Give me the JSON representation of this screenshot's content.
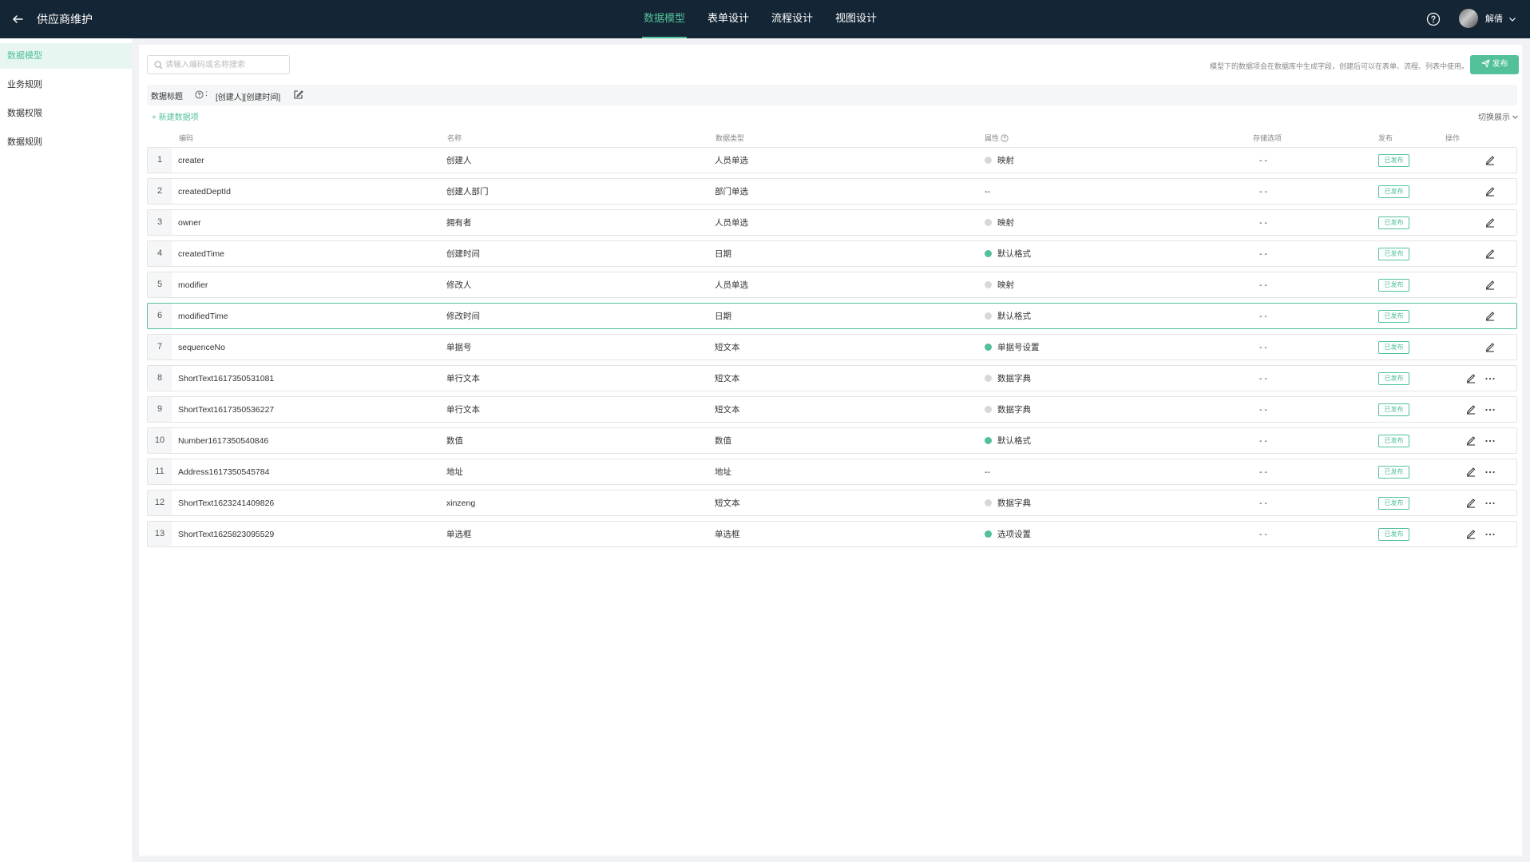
{
  "topbar": {
    "title": "供应商维护",
    "tabs": [
      {
        "label": "数据模型",
        "active": true
      },
      {
        "label": "表单设计",
        "active": false
      },
      {
        "label": "流程设计",
        "active": false
      },
      {
        "label": "视图设计",
        "active": false
      }
    ],
    "username": "解倩"
  },
  "sidebar": {
    "items": [
      {
        "label": "数据模型",
        "active": true
      },
      {
        "label": "业务规则",
        "active": false
      },
      {
        "label": "数据权限",
        "active": false
      },
      {
        "label": "数据规则",
        "active": false
      }
    ]
  },
  "toolbar": {
    "search_placeholder": "请输入编码或名称搜索",
    "hint": "模型下的数据项会在数据库中生成字段，创建后可以在表单、流程、列表中使用。",
    "publish_label": "发布"
  },
  "data_title": {
    "label": "数据标题",
    "colon": ":",
    "value": "[创建人][创建时间]"
  },
  "actions": {
    "new_item": "+ 新建数据项",
    "switch_view": "切换展示"
  },
  "columns": {
    "code": "编码",
    "name": "名称",
    "type": "数据类型",
    "attr": "属性",
    "storage": "存储选项",
    "publish": "发布",
    "ops": "操作"
  },
  "rows": [
    {
      "index": "1",
      "code": "creater",
      "name": "创建人",
      "type": "人员单选",
      "attr": "映射",
      "attr_on": false,
      "storage": "- -",
      "status": "已发布",
      "more": false,
      "selected": false
    },
    {
      "index": "2",
      "code": "createdDeptId",
      "name": "创建人部门",
      "type": "部门单选",
      "attr": "--",
      "attr_on": null,
      "storage": "- -",
      "status": "已发布",
      "more": false,
      "selected": false
    },
    {
      "index": "3",
      "code": "owner",
      "name": "拥有者",
      "type": "人员单选",
      "attr": "映射",
      "attr_on": false,
      "storage": "- -",
      "status": "已发布",
      "more": false,
      "selected": false
    },
    {
      "index": "4",
      "code": "createdTime",
      "name": "创建时间",
      "type": "日期",
      "attr": "默认格式",
      "attr_on": true,
      "storage": "- -",
      "status": "已发布",
      "more": false,
      "selected": false
    },
    {
      "index": "5",
      "code": "modifier",
      "name": "修改人",
      "type": "人员单选",
      "attr": "映射",
      "attr_on": false,
      "storage": "- -",
      "status": "已发布",
      "more": false,
      "selected": false
    },
    {
      "index": "6",
      "code": "modifiedTime",
      "name": "修改时间",
      "type": "日期",
      "attr": "默认格式",
      "attr_on": false,
      "storage": "- -",
      "status": "已发布",
      "more": false,
      "selected": true
    },
    {
      "index": "7",
      "code": "sequenceNo",
      "name": "单据号",
      "type": "短文本",
      "attr": "单据号设置",
      "attr_on": true,
      "storage": "- -",
      "status": "已发布",
      "more": false,
      "selected": false
    },
    {
      "index": "8",
      "code": "ShortText1617350531081",
      "name": "单行文本",
      "type": "短文本",
      "attr": "数据字典",
      "attr_on": false,
      "storage": "- -",
      "status": "已发布",
      "more": true,
      "selected": false
    },
    {
      "index": "9",
      "code": "ShortText1617350536227",
      "name": "单行文本",
      "type": "短文本",
      "attr": "数据字典",
      "attr_on": false,
      "storage": "- -",
      "status": "已发布",
      "more": true,
      "selected": false
    },
    {
      "index": "10",
      "code": "Number1617350540846",
      "name": "数值",
      "type": "数值",
      "attr": "默认格式",
      "attr_on": true,
      "storage": "- -",
      "status": "已发布",
      "more": true,
      "selected": false
    },
    {
      "index": "11",
      "code": "Address1617350545784",
      "name": "地址",
      "type": "地址",
      "attr": "--",
      "attr_on": null,
      "storage": "- -",
      "status": "已发布",
      "more": true,
      "selected": false
    },
    {
      "index": "12",
      "code": "ShortText1623241409826",
      "name": "xinzeng",
      "type": "短文本",
      "attr": "数据字典",
      "attr_on": false,
      "storage": "- -",
      "status": "已发布",
      "more": true,
      "selected": false
    },
    {
      "index": "13",
      "code": "ShortText1625823095529",
      "name": "单选框",
      "type": "单选框",
      "attr": "选项设置",
      "attr_on": true,
      "storage": "- -",
      "status": "已发布",
      "more": true,
      "selected": false
    }
  ],
  "colors": {
    "accent": "#52c19a",
    "topbar_bg": "#142535",
    "sidebar_active_bg": "#e8f6f1"
  }
}
